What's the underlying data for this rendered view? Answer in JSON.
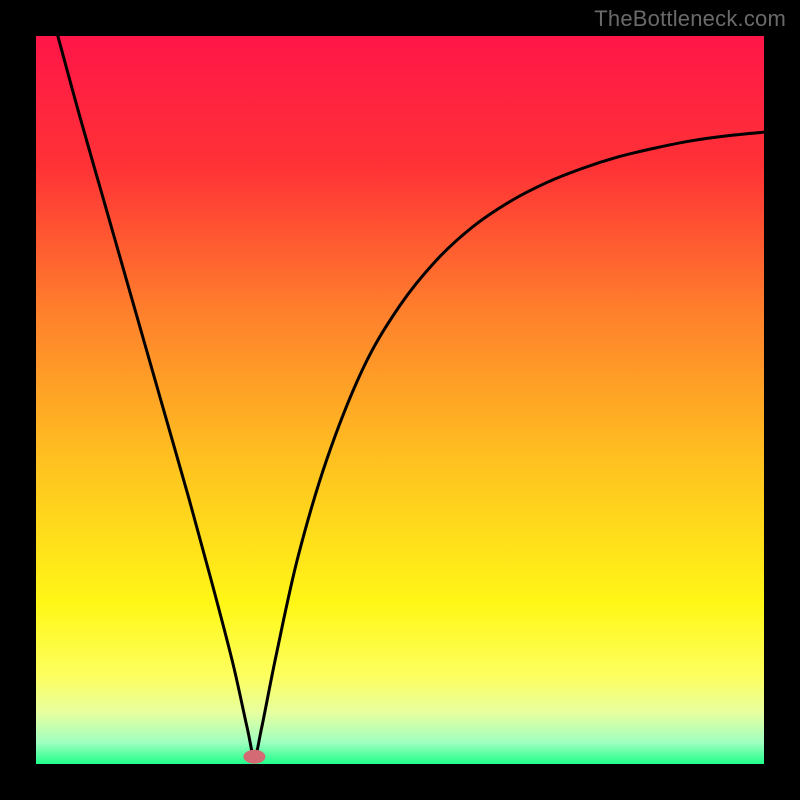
{
  "watermark": "TheBottleneck.com",
  "chart_data": {
    "type": "line",
    "title": "",
    "xlabel": "",
    "ylabel": "",
    "xlim": [
      0,
      100
    ],
    "ylim": [
      0,
      100
    ],
    "grid": false,
    "legend": false,
    "background_gradient": {
      "stops": [
        {
          "offset": 0.0,
          "color": "#ff1648"
        },
        {
          "offset": 0.18,
          "color": "#ff3236"
        },
        {
          "offset": 0.38,
          "color": "#ff802c"
        },
        {
          "offset": 0.58,
          "color": "#ffc020"
        },
        {
          "offset": 0.78,
          "color": "#fff716"
        },
        {
          "offset": 0.88,
          "color": "#fdff60"
        },
        {
          "offset": 0.93,
          "color": "#e6ffa0"
        },
        {
          "offset": 0.97,
          "color": "#a0ffc0"
        },
        {
          "offset": 1.0,
          "color": "#20ff8a"
        }
      ]
    },
    "marker": {
      "x": 30.0,
      "y": 1.0,
      "color": "#d46a74"
    },
    "series": [
      {
        "name": "curve",
        "color": "#000000",
        "x": [
          3.0,
          6.0,
          9.0,
          12.0,
          15.0,
          18.0,
          21.0,
          24.0,
          27.0,
          29.0,
          30.0,
          31.0,
          33.0,
          36.0,
          40.0,
          45.0,
          50.0,
          55.0,
          60.0,
          65.0,
          70.0,
          75.0,
          80.0,
          85.0,
          90.0,
          95.0,
          100.0
        ],
        "y": [
          100.0,
          89.0,
          78.5,
          68.0,
          57.5,
          47.0,
          36.5,
          25.5,
          14.0,
          5.0,
          1.0,
          5.0,
          15.0,
          28.5,
          42.0,
          54.5,
          63.0,
          69.2,
          73.8,
          77.2,
          79.8,
          81.8,
          83.4,
          84.6,
          85.6,
          86.3,
          86.8
        ]
      }
    ]
  }
}
